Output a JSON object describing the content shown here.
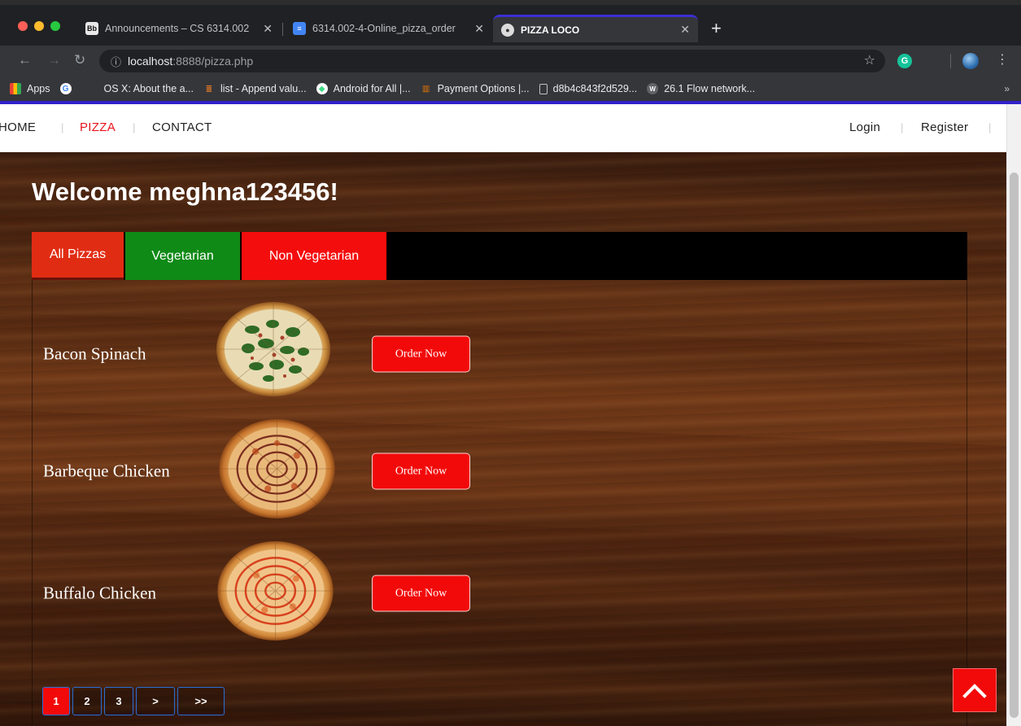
{
  "browser": {
    "tabs": [
      {
        "favicon": "Bb",
        "title": "Announcements – CS 6314.002",
        "active": false
      },
      {
        "favicon": "docs-icon",
        "title": "6314.002-4-Online_pizza_order",
        "active": false
      },
      {
        "favicon": "pizza-favicon",
        "title": "PIZZA LOCO",
        "active": true
      }
    ],
    "new_tab": "+",
    "url_host": "localhost",
    "url_rest": ":8888/pizza.php",
    "extension_letter": "G",
    "bookmarks": [
      {
        "icon": "apps-grid-icon",
        "label": "Apps"
      },
      {
        "icon": "google-icon",
        "label": ""
      },
      {
        "icon": "apple-icon",
        "label": "OS X: About the a..."
      },
      {
        "icon": "stackoverflow-icon",
        "label": "list - Append valu..."
      },
      {
        "icon": "android-icon",
        "label": "Android for All |..."
      },
      {
        "icon": "utd-icon",
        "label": "Payment Options |..."
      },
      {
        "icon": "page-icon",
        "label": "d8b4c843f2d529..."
      },
      {
        "icon": "wiki-icon",
        "label": "26.1 Flow network..."
      }
    ],
    "bookmarks_more": "»"
  },
  "site_nav": {
    "left": [
      {
        "label": "HOME",
        "active": false
      },
      {
        "label": "PIZZA",
        "active": true
      },
      {
        "label": "CONTACT",
        "active": false
      }
    ],
    "right": [
      {
        "label": "Login"
      },
      {
        "label": "Register"
      }
    ]
  },
  "welcome": "Welcome meghna123456!",
  "categories": [
    {
      "label": "All Pizzas",
      "color": "#e12c14",
      "active": true
    },
    {
      "label": "Vegetarian",
      "color": "#0f8a16",
      "active": false
    },
    {
      "label": "Non Vegetarian",
      "color": "#f40d0d",
      "active": false
    }
  ],
  "pizzas": [
    {
      "name": "Bacon Spinach",
      "image": "bacon-spinach-pizza",
      "button": "Order Now"
    },
    {
      "name": "Barbeque Chicken",
      "image": "barbeque-chicken-pizza",
      "button": "Order Now"
    },
    {
      "name": "Buffalo Chicken",
      "image": "buffalo-chicken-pizza",
      "button": "Order Now"
    }
  ],
  "pagination": [
    {
      "label": "1",
      "active": true
    },
    {
      "label": "2",
      "active": false
    },
    {
      "label": "3",
      "active": false
    },
    {
      "label": ">",
      "active": false
    },
    {
      "label": ">>",
      "active": false
    }
  ],
  "back_to_top": "chevron-up-icon",
  "colors": {
    "accent_red": "#f20a0a",
    "nav_active": "#e8141b",
    "veg_green": "#0f8a16",
    "browser_accent": "#2f22c9"
  }
}
